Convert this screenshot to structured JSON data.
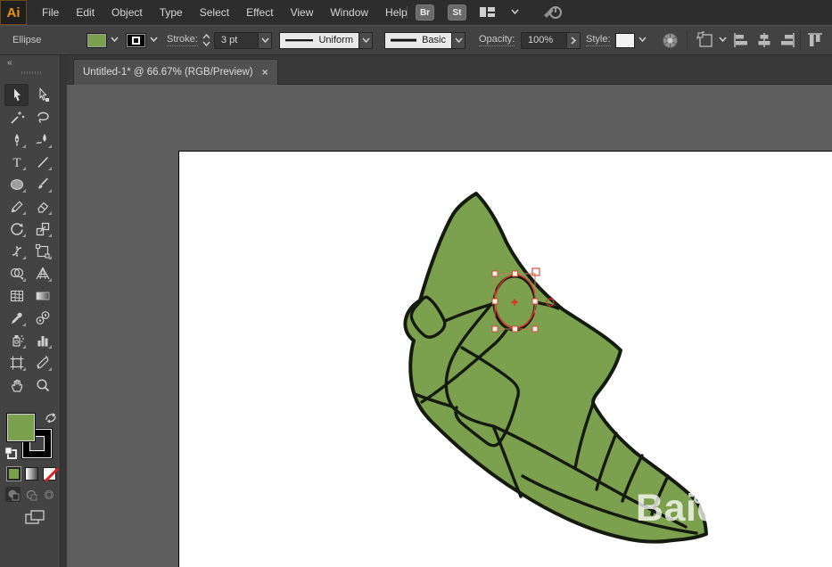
{
  "menubar": {
    "logo": "Ai",
    "items": [
      "File",
      "Edit",
      "Object",
      "Type",
      "Select",
      "Effect",
      "View",
      "Window",
      "Help"
    ],
    "br_button": "Br",
    "st_button": "St"
  },
  "controlbar": {
    "context_label": "Ellipse",
    "stroke_label": "Stroke:",
    "stroke_weight": "3 pt",
    "variable_width_profile": "Uniform",
    "brush_definition": "Basic",
    "opacity_label": "Opacity:",
    "opacity_value": "100%",
    "style_label": "Style:"
  },
  "document_tab": {
    "title": "Untitled-1* @ 66.67% (RGB/Preview)",
    "close": "×"
  },
  "tool_names": [
    "selection",
    "direct-selection",
    "magic-wand",
    "lasso",
    "pen",
    "curvature-pen",
    "type",
    "line-segment",
    "ellipse",
    "paintbrush",
    "pencil",
    "eraser",
    "rotate",
    "scale",
    "width",
    "free-transform",
    "shape-builder",
    "perspective-grid",
    "mesh",
    "gradient",
    "eyedropper",
    "blend",
    "symbol-sprayer",
    "column-graph",
    "artboard",
    "slice",
    "hand",
    "zoom"
  ],
  "type_tool_glyph": "T",
  "panel_collapse_glyph": "«",
  "drawing": {
    "subject": "metapod-line-art",
    "fill_color": "#7CA14E",
    "fill_swatch_style": "background:#7CA14E",
    "outline_color": "#151A0F",
    "selection_color": "#D8382E",
    "bbox_color": "#C1794F",
    "handle_fill": "#FBF0E8"
  },
  "watermark": {
    "text": "Baidu"
  },
  "colors": {
    "canvas": "#5E5E5E",
    "artboard": "#FFFFFF",
    "ui_dark": "#2D2D2D",
    "ui_mid": "#424242"
  }
}
